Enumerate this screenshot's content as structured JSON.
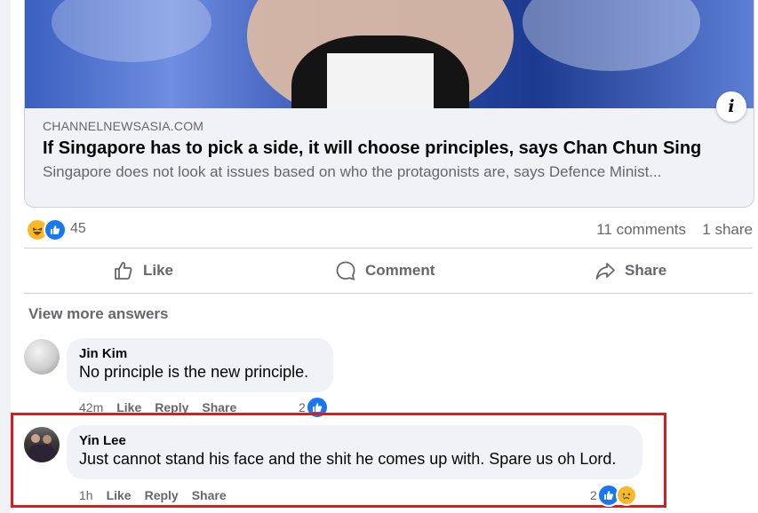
{
  "link_preview": {
    "domain": "CHANNELNEWSASIA.COM",
    "title": "If Singapore has to pick a side, it will choose principles, says Chan Chun Sing",
    "description": "Singapore does not look at issues based on who the protagonists are, says Defence Minist...",
    "info_icon": "info-icon"
  },
  "reactions": {
    "icons": [
      "haha-icon",
      "like-icon"
    ],
    "count": "45",
    "comments": "11 comments",
    "shares": "1 share"
  },
  "actions": {
    "like": "Like",
    "comment": "Comment",
    "share": "Share"
  },
  "comments_section": {
    "view_more": "View more answers",
    "items": [
      {
        "author": "Jin Kim",
        "text": "No principle is the new principle.",
        "time": "42m",
        "like": "Like",
        "reply": "Reply",
        "share": "Share",
        "reaction_count": "2"
      },
      {
        "author": "Yin Lee",
        "text": "Just cannot stand his face and the shit he comes up with. Spare us oh Lord.",
        "time": "1h",
        "like": "Like",
        "reply": "Reply",
        "share": "Share",
        "reaction_count": "2"
      }
    ]
  },
  "colors": {
    "accent": "#1877f2",
    "highlight_border": "#d71c24",
    "secondary_text": "#65676b"
  }
}
